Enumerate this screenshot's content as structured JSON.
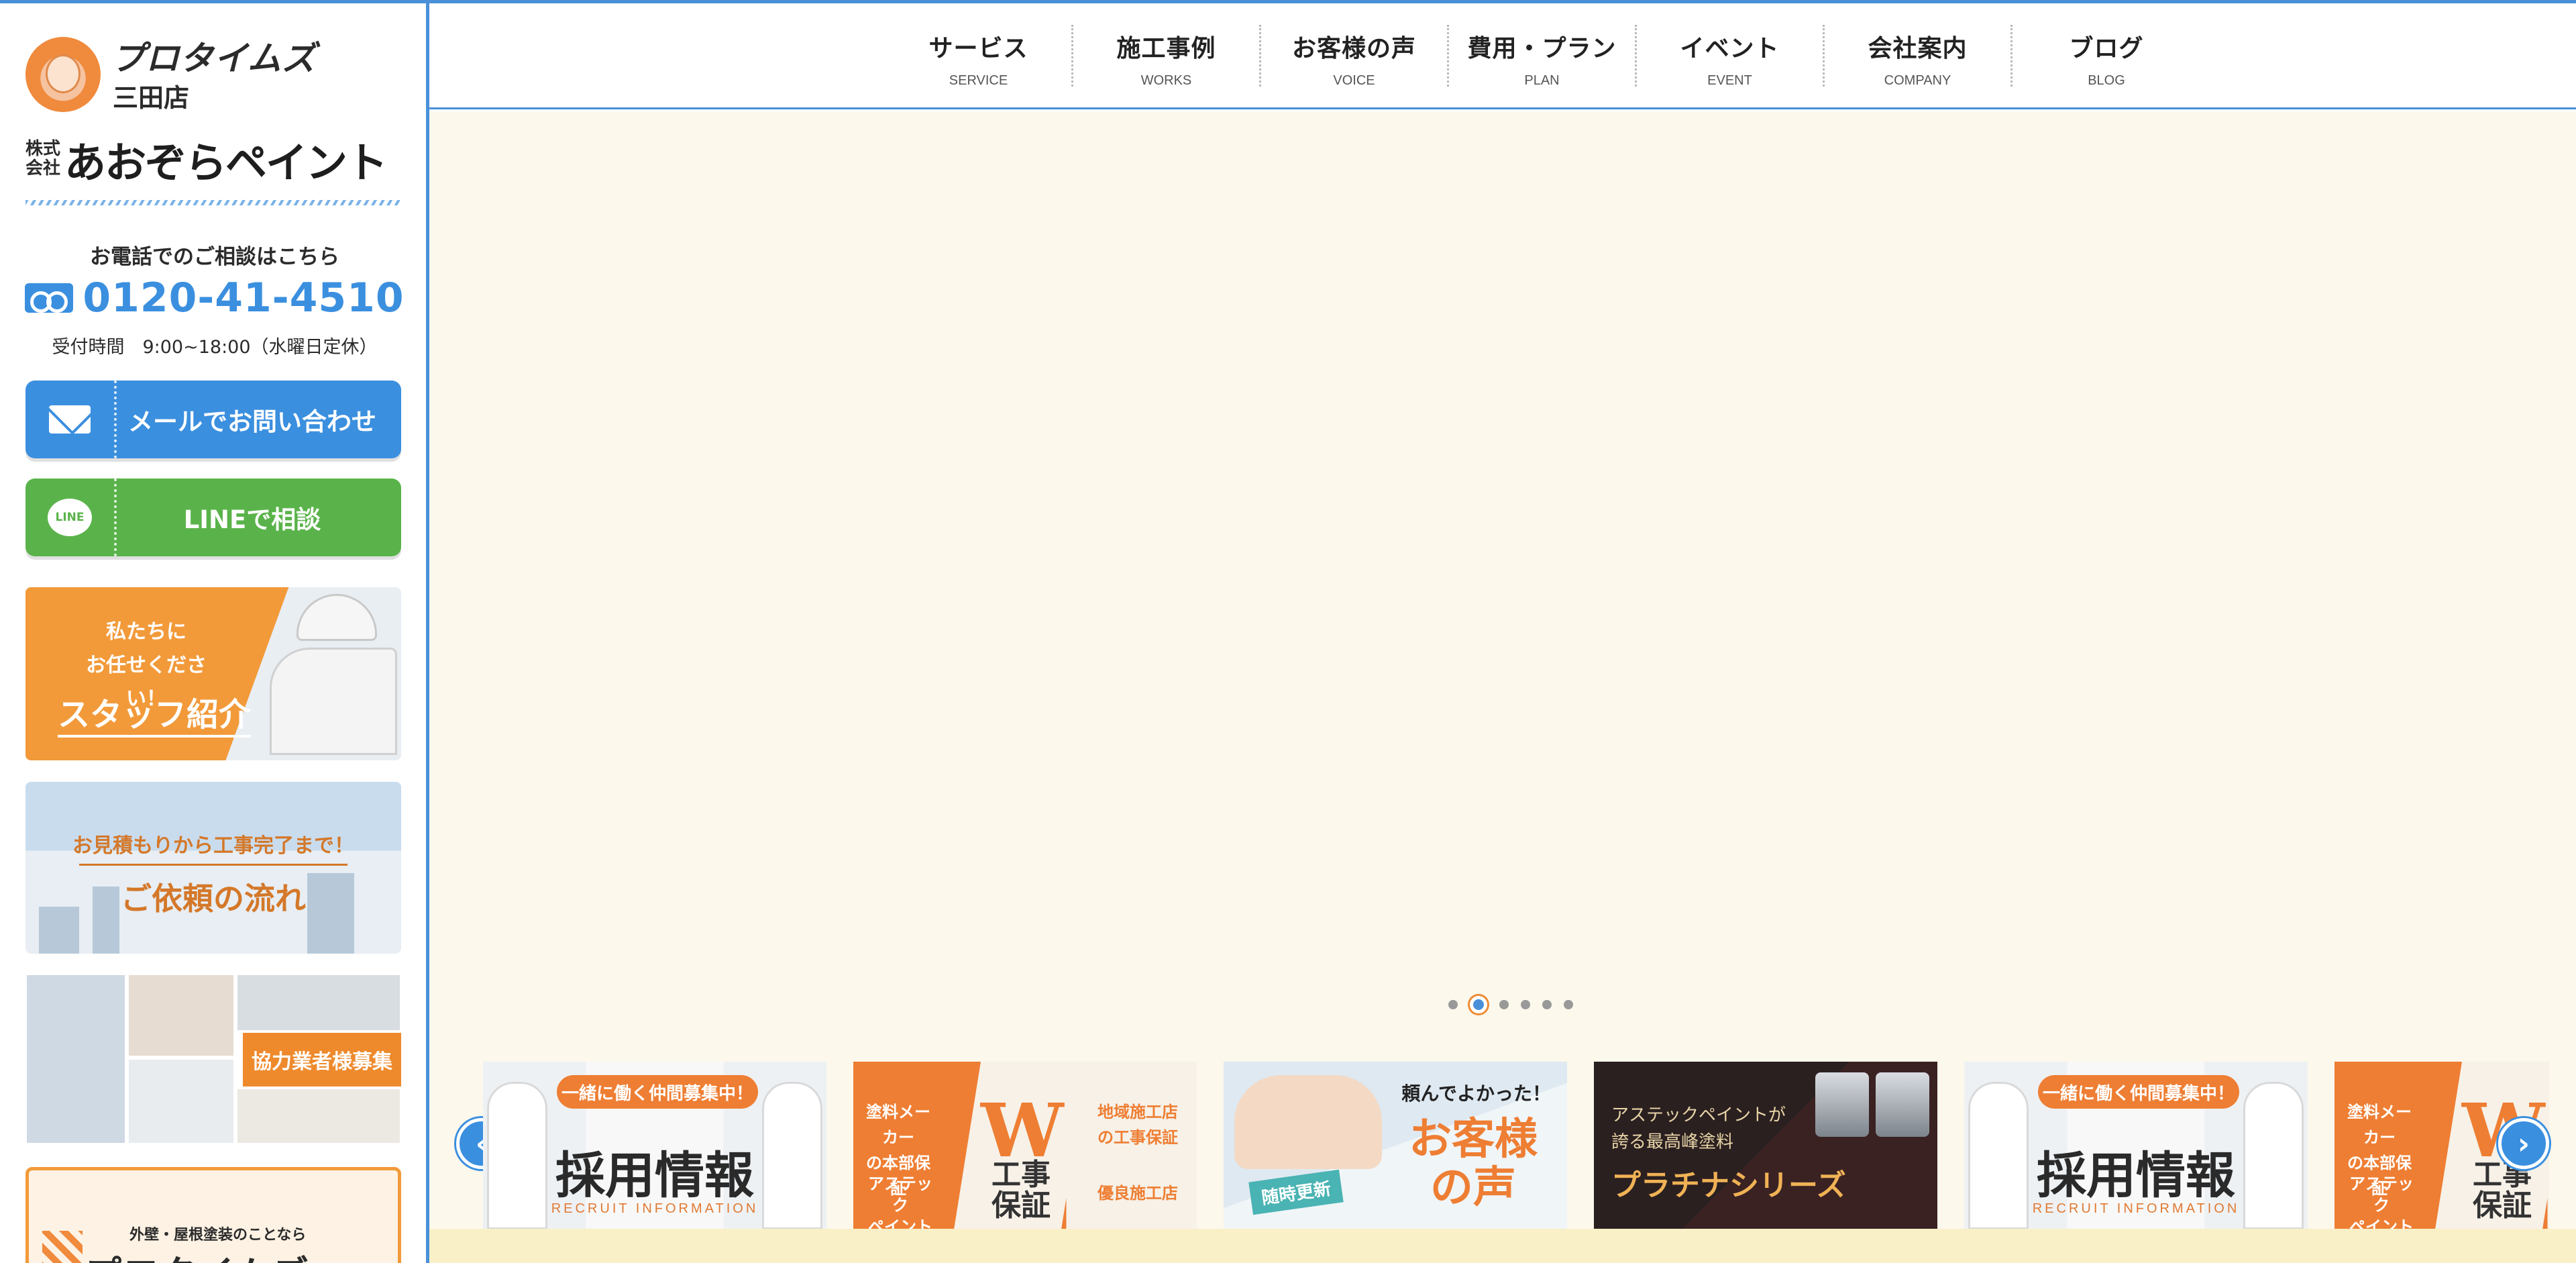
{
  "sidebar": {
    "brand_line1": "プロタイムズ",
    "brand_line2": "三田店",
    "company_prefix_1": "株式",
    "company_prefix_2": "会社",
    "company_name": "あおぞらペイント",
    "tel_label": "お電話でのご相談はこちら",
    "tel_number": "0120-41-4510",
    "tel_hours": "受付時間　9:00~18:00（水曜日定休）",
    "mail_button": "メールでお問い合わせ",
    "line_button": "LINEで相談",
    "line_icon_text": "LINE",
    "banners": {
      "staff_line1": "私たちに",
      "staff_line2": "お任せください！",
      "staff_title": "スタッフ紹介",
      "flow_sub": "お見積もりから工事完了まで！",
      "flow_title": "ご依頼の流れ",
      "partner_tag": "協力業者様募集",
      "pro_sub": "外壁・屋根塗装のことなら",
      "pro_title": "プロタイムズ"
    }
  },
  "nav": [
    {
      "jp": "サービス",
      "en": "SERVICE"
    },
    {
      "jp": "施工事例",
      "en": "WORKS"
    },
    {
      "jp": "お客様の声",
      "en": "VOICE"
    },
    {
      "jp": "費用・プラン",
      "en": "PLAN"
    },
    {
      "jp": "イベント",
      "en": "EVENT"
    },
    {
      "jp": "会社案内",
      "en": "COMPANY"
    },
    {
      "jp": "ブログ",
      "en": "BLOG"
    }
  ],
  "hero": {
    "dots_total": 6,
    "active_dot": 2
  },
  "carousel": {
    "prev_label": "‹",
    "next_label": "›",
    "recruit": {
      "pill": "一緒に働く仲間募集中！",
      "title": "採用情報",
      "sub": "RECRUIT INFORMATION"
    },
    "warranty": {
      "left1": "塗料メーカー",
      "left2": "の本部保証",
      "left3": "アステック",
      "left4": "ペイント",
      "big": "W",
      "big2": "工事",
      "big3": "保証",
      "right1": "地域施工店",
      "right2": "の工事保証",
      "right3": "優良施工店"
    },
    "voice": {
      "top": "頼んでよかった！",
      "title": "お客様の声",
      "tag": "随時更新"
    },
    "platinum": {
      "line1": "アステックペイントが",
      "line2": "誇る最高峰塗料",
      "title": "プラチナシリーズ"
    }
  },
  "colors": {
    "accent_blue": "#3b8fdf",
    "line_green": "#5ab34a",
    "orange": "#ee7e33",
    "hero_bg": "#fcf8ec"
  }
}
